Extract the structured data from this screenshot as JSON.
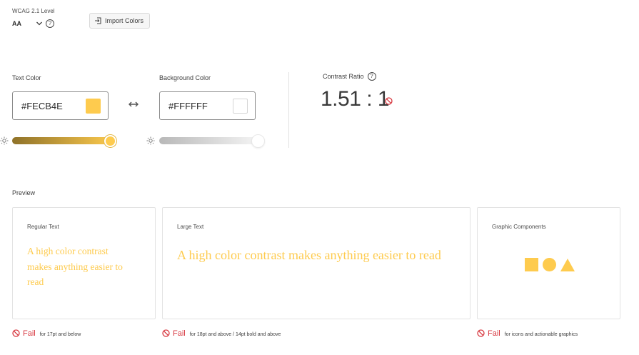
{
  "wcag": {
    "label": "WCAG 2.1 Level",
    "value": "AA",
    "help": "?"
  },
  "import_button": {
    "label": "Import Colors"
  },
  "text_color": {
    "label": "Text Color",
    "value": "#FECB4E",
    "swatch": "#FECB4E"
  },
  "background_color": {
    "label": "Background Color",
    "value": "#FFFFFF",
    "swatch": "#FFFFFF"
  },
  "contrast": {
    "label": "Contrast Ratio",
    "help": "?",
    "value": "1.51 : 1",
    "status": "fail"
  },
  "preview": {
    "label": "Preview",
    "regular": {
      "title": "Regular Text",
      "sample": "A high color contrast makes anything easier to read",
      "status": "Fail",
      "note": "for 17pt and below"
    },
    "large": {
      "title": "Large Text",
      "sample": "A high color contrast makes anything easier to read",
      "status": "Fail",
      "note": "for 18pt and above / 14pt bold and above"
    },
    "graphic": {
      "title": "Graphic Components",
      "status": "Fail",
      "note": "for icons and actionable graphics"
    }
  },
  "colors": {
    "accent": "#FECB4E",
    "fail": "#D7373F",
    "border": "#8A8A8A"
  }
}
